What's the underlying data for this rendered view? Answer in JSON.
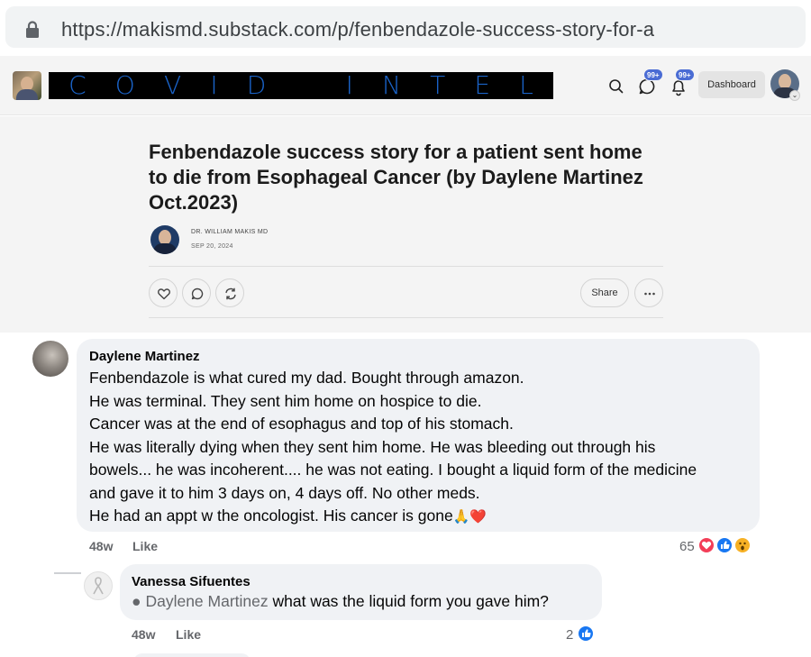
{
  "browser": {
    "url": "https://makismd.substack.com/p/fenbendazole-success-story-for-a",
    "lock_icon": "lock-icon"
  },
  "header": {
    "publication_title_letters": [
      "C",
      "O",
      "V",
      "I",
      "D",
      "I",
      "N",
      "T",
      "E",
      "L"
    ],
    "notification_badges": [
      "99+",
      "99+"
    ],
    "dashboard_label": "Dashboard",
    "icons": [
      "search-icon",
      "chat-icon",
      "bell-icon"
    ]
  },
  "article": {
    "title": "Fenbendazole success story for a patient sent home to die from Esophageal Cancer (by Daylene Martinez Oct.2023)",
    "author": "DR. WILLIAM MAKIS MD",
    "date": "SEP 20, 2024",
    "share_label": "Share",
    "action_icons": [
      "heart-icon",
      "comment-icon",
      "restack-icon",
      "more-icon"
    ]
  },
  "comment": {
    "name": "Daylene Martinez",
    "lines": [
      "Fenbendazole is what cured my dad. Bought through amazon.",
      "He was terminal. They sent him home on hospice to die.",
      "Cancer was at the end of esophagus and top of his stomach.",
      "He was literally dying when they sent him home. He was bleeding out through his",
      "bowels... he was incoherent.... he was not eating. I bought a liquid form of the medicine",
      "and gave it to him 3 days on, 4 days off. No other meds.",
      "He had an appt w the oncologist. His cancer is gone"
    ],
    "emoji": "🙏❤️",
    "time": "48w",
    "like_label": "Like",
    "reaction_count": "65",
    "reaction_icons": [
      "love-reaction-icon",
      "like-reaction-icon",
      "wow-reaction-icon"
    ]
  },
  "reply": {
    "name": "Vanessa Sifuentes",
    "mention": "Daylene Martinez",
    "text": " what was the liquid form you gave him?",
    "time": "48w",
    "like_label": "Like",
    "reaction_count": "2",
    "reaction_icons": [
      "like-reaction-icon"
    ]
  },
  "colors": {
    "header_bg": "#f4f4f4",
    "title_banner_bg": "#000000",
    "title_banner_text": "#1a63c8",
    "badge": "#4a6cd4",
    "fb_bubble": "#f0f2f5",
    "fb_like_blue": "#1877f2",
    "fb_love_red": "#f33e58"
  }
}
